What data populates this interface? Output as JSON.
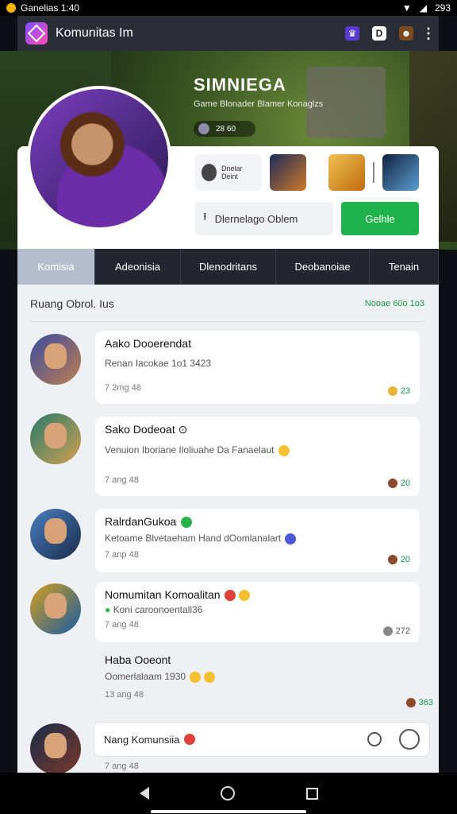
{
  "statusbar": {
    "left_text": "Ganelias 1:40",
    "right_text": "293"
  },
  "appbar": {
    "title": "Komunitas Im"
  },
  "hero": {
    "title": "SIMNIEGA",
    "subtitle": "Game Blonader Blamer Konaglzs",
    "chip_text": "28   60"
  },
  "profile": {
    "badge_chip_text": "Dnelar Deint",
    "action_button": "Dlernelago Oblem",
    "primary_button": "Gelhle"
  },
  "tabs": [
    "Komisia",
    "Adeonisia",
    "Dlenodritans",
    "Deobanoiae",
    "Tenain"
  ],
  "section": {
    "title": "Ruang Obrol. Ius",
    "more": "Nooae 60o 1o3"
  },
  "messages": [
    {
      "name": "Aako Dooerendat",
      "text": "Renan Iacokae 1o1 3423",
      "time": "7 2mg  48",
      "react": "23"
    },
    {
      "name": "Sako Dodeoat",
      "text": "Venuion Iboriane Iloliuahe Da Fanaelaut",
      "time": "7 ang  48",
      "react": "20"
    },
    {
      "name": "RalrdanGukoa",
      "text": "Ketoame  Blvetaeham Hand dOomlanalart",
      "time": "7 anp  48",
      "react": "20"
    },
    {
      "name": "Nomumitan Komoalitan",
      "text": "Koni caroonoentall36",
      "time": "7 ang  48",
      "react": "272"
    },
    {
      "name": "Haba Ooeont",
      "text": "Oomerlalaam   1930",
      "time": "13 ang  48",
      "react": "363"
    }
  ],
  "input": {
    "placeholder": "Nang Komunsiia"
  },
  "last_row_time": "7 ang  48"
}
